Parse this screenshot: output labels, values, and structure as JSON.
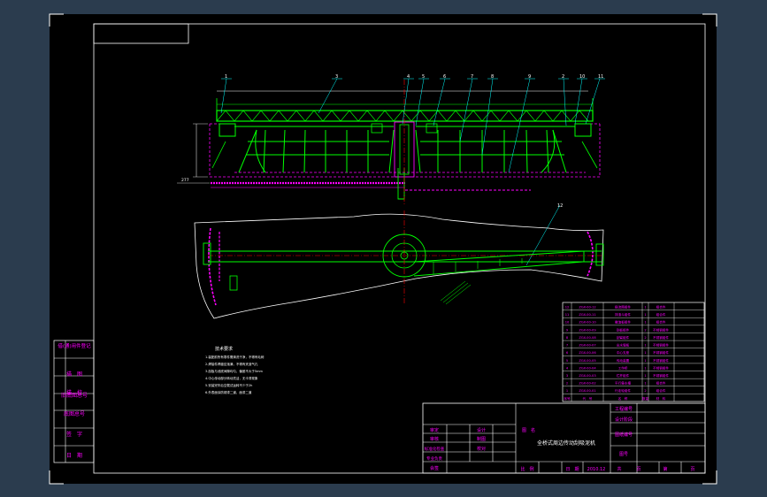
{
  "colors": {
    "background": "#2b3c4e",
    "paper": "#000000",
    "frame": "#ffffff",
    "structure": "#00ff00",
    "centerline": "#ff0000",
    "hidden": "#ff00ff",
    "balloon": "#00ffff",
    "text_magenta": "#ff00ff"
  },
  "left_stamp": {
    "rows": [
      "借(通)用件登记",
      "描　图",
      "描　校",
      "旧底图总号",
      "底图总号",
      "签　字",
      "日　期"
    ]
  },
  "balloons": [
    "1",
    "2",
    "3",
    "4",
    "5",
    "6",
    "7",
    "8",
    "9",
    "10",
    "11",
    "12"
  ],
  "dimension_labels": [
    "277"
  ],
  "tech_notes": {
    "title": "技术要求",
    "lines": [
      "1.装配前所有零件需清洗干净，不得有毛刺",
      "2.焊接件焊缝应饱满，不得有夹渣气孔",
      "3.刮板与池底间隙均匀，偏差不大于5mm",
      "4.中心传动部分转动灵活，无卡滞现象",
      "5.安装完毕后空载试运转不少于2h",
      "6.外表面涂防锈漆二道，面漆二道"
    ]
  },
  "parts_list": {
    "rows": [
      {
        "no": "12",
        "code": "ZGX-00-12",
        "name": "稳流筒组件",
        "qty": "1",
        "material": "组合件"
      },
      {
        "no": "11",
        "code": "ZGX-00-11",
        "name": "排渣斗组件",
        "qty": "1",
        "material": "组合件"
      },
      {
        "no": "10",
        "code": "ZGX-00-10",
        "name": "撇渣板组件",
        "qty": "1",
        "material": "组合件"
      },
      {
        "no": "9",
        "code": "ZGX-00-09",
        "name": "刮板组件",
        "qty": "2",
        "material": "不锈钢组件"
      },
      {
        "no": "8",
        "code": "ZGX-00-08",
        "name": "刮臂组件",
        "qty": "2",
        "material": "不锈钢组件"
      },
      {
        "no": "7",
        "code": "ZGX-00-07",
        "name": "出水堰板",
        "qty": "1",
        "material": "不锈钢组件"
      },
      {
        "no": "6",
        "code": "ZGX-00-06",
        "name": "中心支座",
        "qty": "1",
        "material": "不锈钢组件"
      },
      {
        "no": "5",
        "code": "ZGX-00-05",
        "name": "传动装置",
        "qty": "1",
        "material": "不锈钢组件"
      },
      {
        "no": "4",
        "code": "ZGX-00-04",
        "name": "工作桥",
        "qty": "1",
        "material": "不锈钢组件"
      },
      {
        "no": "3",
        "code": "ZGX-00-03",
        "name": "栏杆组件",
        "qty": "1",
        "material": "不锈钢组件"
      },
      {
        "no": "2",
        "code": "ZGX-00-02",
        "name": "平行集水槽",
        "qty": "1",
        "material": "组合件"
      },
      {
        "no": "1",
        "code": "ZGX-00-01",
        "name": "行走轮组件",
        "qty": "2",
        "material": "组合件"
      }
    ],
    "header": {
      "no": "序号",
      "code": "代　号",
      "name": "名　称",
      "qty": "数量",
      "material": "材　料"
    }
  },
  "title_block": {
    "left_labels": [
      "审定",
      "审核",
      "标准化检查",
      "专业负责",
      "会签"
    ],
    "mid_labels": [
      "设计",
      "制图",
      "校对"
    ],
    "drawing_name_label": "图　名",
    "drawing_name": "全桥式周边传动刮吸泥机",
    "right_labels": [
      "工程编号",
      "设计阶段",
      "图纸编号",
      "图号"
    ],
    "bottom_scale_label": "比　例",
    "bottom_date_label": "日　期",
    "date": "2010.12",
    "total_label": "共",
    "total_unit": "页",
    "page_label": "第",
    "page_unit": "页"
  }
}
